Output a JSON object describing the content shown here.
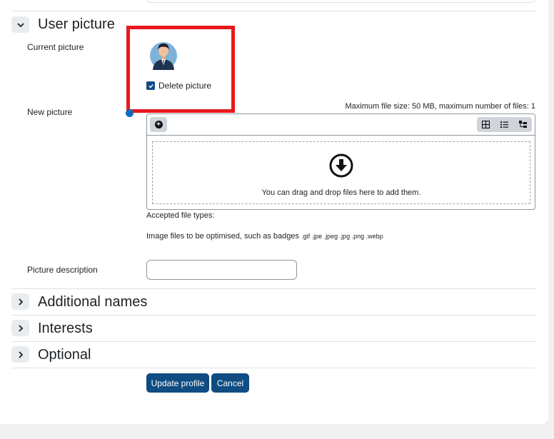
{
  "sections": {
    "user_picture": "User picture",
    "additional_names": "Additional names",
    "interests": "Interests",
    "optional": "Optional"
  },
  "current_picture": {
    "label": "Current picture",
    "delete_label": "Delete picture",
    "delete_checked": true
  },
  "new_picture": {
    "label": "New picture",
    "limits": "Maximum file size: 50 MB, maximum number of files: 1",
    "dropzone_text": "You can drag and drop files here to add them.",
    "accepted_label": "Accepted file types:",
    "types_description": "Image files to be optimised, such as badges",
    "types_extensions": ".gif .jpe .jpeg .jpg .png .webp"
  },
  "picture_description": {
    "label": "Picture description",
    "value": ""
  },
  "buttons": {
    "update": "Update profile",
    "cancel": "Cancel"
  },
  "icons": {
    "toggle_open": "chevron-down-icon",
    "toggle_closed": "chevron-right-icon",
    "add_file": "plus-circle-icon",
    "view_icons": "grid-icon",
    "view_list": "list-icon",
    "view_tree": "tree-icon",
    "dropzone": "download-arrow-circle-icon",
    "help": "help-icon"
  },
  "colors": {
    "primary": "#0f4c81",
    "highlight": "#e8191e",
    "toggle_bg": "#e9ecef"
  }
}
